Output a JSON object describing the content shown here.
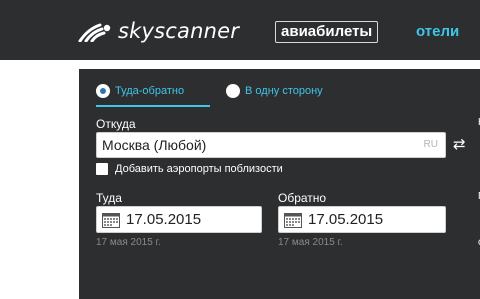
{
  "header": {
    "logo_text": "skyscanner",
    "tabs": [
      {
        "label": "авиабилеты",
        "active": true
      },
      {
        "label": "отели",
        "active": false
      }
    ]
  },
  "search": {
    "trip_types": [
      {
        "label": "Туда-обратно",
        "selected": true
      },
      {
        "label": "В одну сторону",
        "selected": false
      }
    ],
    "from": {
      "label": "Откуда",
      "value": "Москва (Любой)",
      "country_code": "RU"
    },
    "swap_icon": "swap-arrows-icon",
    "nearby_airports": {
      "label": "Добавить аэропорты поблизости",
      "checked": false
    },
    "depart": {
      "label": "Туда",
      "value": "17.05.2015",
      "hint": "17 мая 2015 г."
    },
    "return": {
      "label": "Обратно",
      "value": "17.05.2015",
      "hint": "17 мая 2015 г."
    },
    "right_edge": {
      "to_label_fragment": "К",
      "passengers_label_fragment": "П",
      "hint_fragment": "с"
    }
  },
  "colors": {
    "header_bg": "#2d2e30",
    "accent": "#3ec6e8",
    "selected_radio": "#2d76b6"
  }
}
